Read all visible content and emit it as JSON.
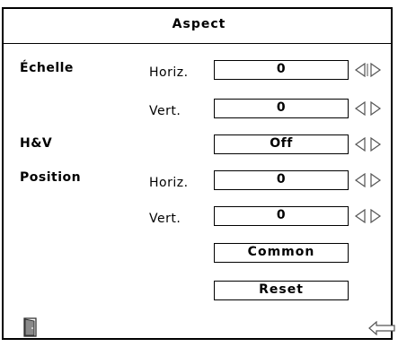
{
  "window": {
    "title": "Aspect"
  },
  "scale": {
    "label": "Échelle",
    "horiz": {
      "label": "Horiz.",
      "value": "0"
    },
    "vert": {
      "label": "Vert.",
      "value": "0"
    }
  },
  "hv": {
    "label": "H&V",
    "value": "Off"
  },
  "position": {
    "label": "Position",
    "horiz": {
      "label": "Horiz.",
      "value": "0"
    },
    "vert": {
      "label": "Vert.",
      "value": "0"
    }
  },
  "buttons": {
    "common": "Common",
    "reset": "Reset"
  },
  "icons": {
    "exit": "door-exit-icon",
    "back": "back-arrow-icon",
    "adjust": "left-right-arrows-icon"
  }
}
